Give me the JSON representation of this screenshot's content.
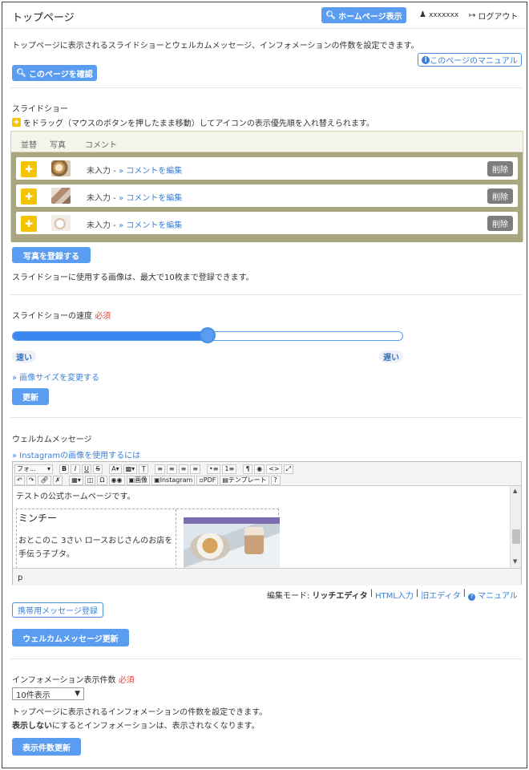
{
  "header": {
    "title": "トップページ",
    "homepage_button": "ホームページ表示",
    "username": "xxxxxxx",
    "logout": "ログアウト"
  },
  "intro": {
    "description": "トップページに表示されるスライドショーとウェルカムメッセージ、インフォメーションの件数を設定できます。",
    "manual_link": "このページのマニュアル",
    "confirm_button": "このページを確認"
  },
  "slideshow": {
    "heading": "スライドショー",
    "drag_hint": "をドラッグ（マウスのボタンを押したまま移動）してアイコンの表示優先順を入れ替えられます。",
    "columns": [
      "並替",
      "写真",
      "コメント"
    ],
    "rows": [
      {
        "status": "未入力 - ",
        "edit_link": "» コメントを編集",
        "delete": "削除"
      },
      {
        "status": "未入力 - ",
        "edit_link": "» コメントを編集",
        "delete": "削除"
      },
      {
        "status": "未入力 - ",
        "edit_link": "» コメントを編集",
        "delete": "削除"
      }
    ],
    "register_button": "写真を登録する",
    "limit_note": "スライドショーに使用する画像は、最大で10枚まで登録できます。"
  },
  "speed": {
    "label": "スライドショーの速度",
    "required": "必須",
    "fast": "速い",
    "slow": "遅い",
    "value_fraction": 0.5,
    "resize_link": "» 画像サイズを変更する",
    "update_button": "更新"
  },
  "welcome": {
    "heading": "ウェルカムメッセージ",
    "instagram_link": "» Instagramの画像を使用するには",
    "toolbar": {
      "font": "フォ...",
      "image": "画像",
      "instagram": "Instagram",
      "pdf": "PDF",
      "template": "テンプレート"
    },
    "content_line1": "テストの公式ホームページです。",
    "content_name": "ミンチー",
    "content_desc_1": "おとこのこ 3さい ロースおじさんのお店を",
    "content_desc_2": "手伝う子ブタ。",
    "status_path": "p",
    "mode_label": "編集モード: ",
    "mode_rich": "リッチエディタ",
    "mode_html": "HTML入力",
    "mode_old": "旧エディタ",
    "mode_manual": "マニュアル",
    "mobile_button": "携帯用メッセージ登録",
    "update_button": "ウェルカムメッセージ更新"
  },
  "info": {
    "label": "インフォメーション表示件数",
    "required": "必須",
    "selected": "10件表示",
    "note1": "トップページに表示されるインフォメーションの件数を設定できます。",
    "note2_bold": "表示しない",
    "note2_rest": "にするとインフォメーションは、表示されなくなります。",
    "update_button": "表示件数更新"
  },
  "colors": {
    "accent": "#5a9cf0",
    "link": "#3b7fd6",
    "required": "#e0443a",
    "drag_yellow": "#f5c400",
    "panel_olive": "#a9a680"
  }
}
